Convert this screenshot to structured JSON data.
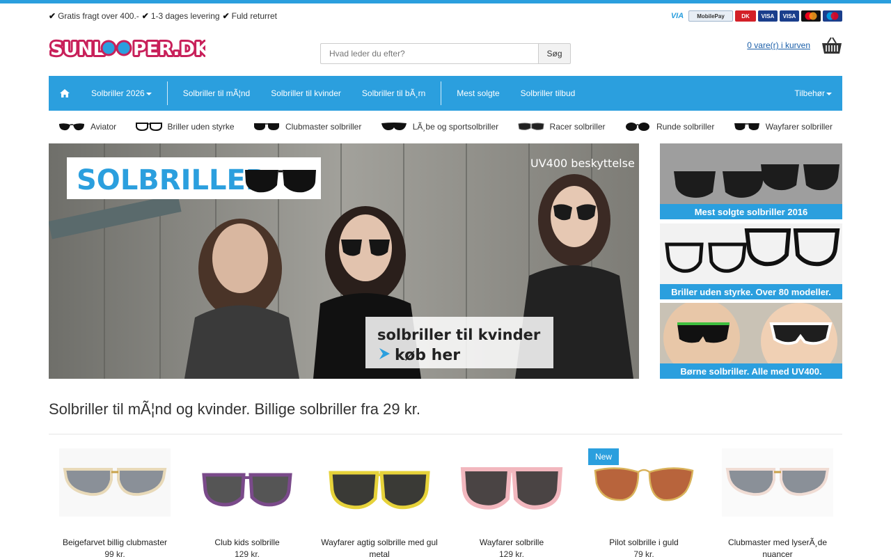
{
  "usps": [
    "Gratis fragt over 400.-",
    "1-3 dages levering",
    "Fuld returret"
  ],
  "payment_logos": [
    "VIA",
    "MobilePay",
    "DK",
    "VISA",
    "VISA",
    "MasterCard",
    "Maestro"
  ],
  "logo_text": "SUNLOOPER.DK",
  "search": {
    "placeholder": "Hvad leder du efter?",
    "button": "Søg"
  },
  "cart": {
    "label": "0 vare(r) i kurven"
  },
  "nav": {
    "items": [
      "Solbriller 2026",
      "Solbriller til mÃ¦nd",
      "Solbriller til kvinder",
      "Solbriller til bÃ¸rn",
      "Mest solgte",
      "Solbriller tilbud"
    ],
    "right": "Tilbehør"
  },
  "categories": [
    "Aviator",
    "Briller uden styrke",
    "Clubmaster solbriller",
    "LÃ¸be og sportsolbriller",
    "Racer solbriller",
    "Runde solbriller",
    "Wayfarer solbriller"
  ],
  "banner": {
    "title": "SOLBRILLER",
    "uv": "UV400 beskyttelse",
    "line1": "solbriller til kvinder",
    "line2": "køb her"
  },
  "side_banners": [
    "Mest solgte solbriller 2016",
    "Briller uden styrke. Over 80 modeller.",
    "Børne solbriller. Alle med UV400."
  ],
  "heading": "Solbriller til mÃ¦nd og kvinder. Billige solbriller fra 29 kr.",
  "products": [
    {
      "name": "Beigefarvet billig clubmaster",
      "price": "99 kr.",
      "badge": ""
    },
    {
      "name": "Club kids solbrille",
      "price": "129 kr.",
      "badge": ""
    },
    {
      "name": "Wayfarer agtig solbrille med gul metal",
      "price": "",
      "badge": ""
    },
    {
      "name": "Wayfarer solbrille",
      "price": "129 kr.",
      "badge": ""
    },
    {
      "name": "Pilot solbrille i guld",
      "price": "79 kr.",
      "badge": "New"
    },
    {
      "name": "Clubmaster med lyserÃ¸de nuancer",
      "price": "",
      "badge": ""
    }
  ],
  "colors": {
    "accent": "#2b9fde",
    "link": "#1a5ea8"
  }
}
